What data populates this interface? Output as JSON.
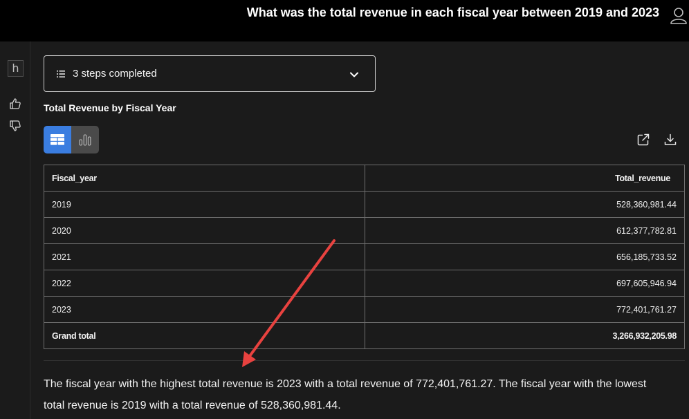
{
  "header": {
    "question": "What was the total revenue in each fiscal year between 2019 and 2023",
    "user_icon": "user-icon"
  },
  "sidebar": {
    "avatar_letter": "h",
    "icons": [
      "thumbs-up-icon",
      "thumbs-down-icon"
    ]
  },
  "steps": {
    "label": "3 steps completed",
    "icon": "list-icon",
    "expand_icon": "chevron-down-icon"
  },
  "result": {
    "title": "Total Revenue by Fiscal Year",
    "view_toggle": [
      "table-view-icon",
      "chart-view-icon"
    ],
    "active_view": "table",
    "toolbar_icons": [
      "open-external-icon",
      "download-icon"
    ],
    "table": {
      "columns": [
        "Fiscal_year",
        "Total_revenue"
      ],
      "rows": [
        [
          "2019",
          "528,360,981.44"
        ],
        [
          "2020",
          "612,377,782.81"
        ],
        [
          "2021",
          "656,185,733.52"
        ],
        [
          "2022",
          "697,605,946.94"
        ],
        [
          "2023",
          "772,401,761.27"
        ]
      ],
      "total": [
        "Grand total",
        "3,266,932,205.98"
      ]
    },
    "summary": "The fiscal year with the highest total revenue is 2023 with a total revenue of 772,401,761.27. The fiscal year with the lowest total revenue is 2019 with a total revenue of 528,360,981.44."
  },
  "colors": {
    "background": "#1b1b1b",
    "topbar": "#000000",
    "accent": "#3a7de0",
    "annotation_arrow": "#e8423f"
  }
}
